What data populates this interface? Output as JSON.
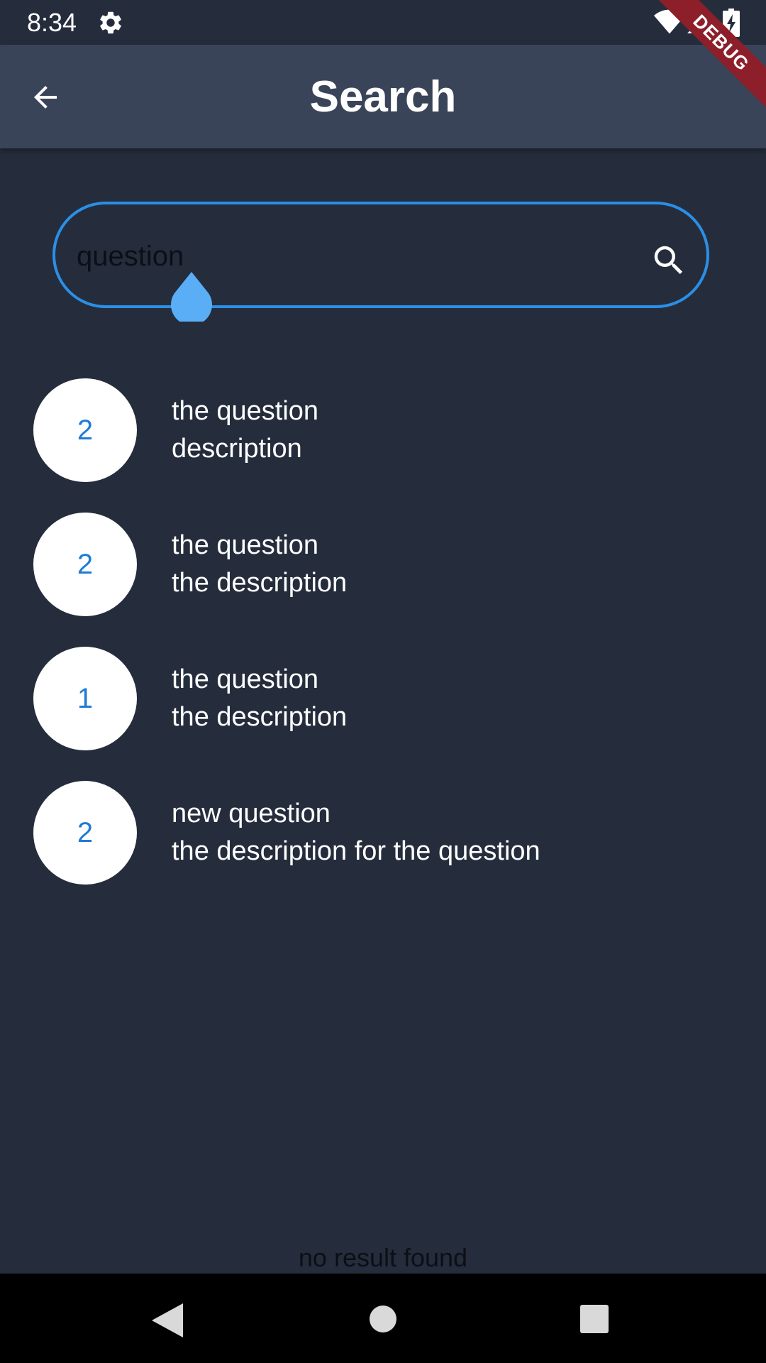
{
  "status_bar": {
    "time": "8:34",
    "icons": [
      "gear-icon",
      "wifi-icon",
      "signal-icon",
      "battery-charging-icon"
    ]
  },
  "debug_banner": "DEBUG",
  "app_bar": {
    "title": "Search",
    "back_icon": "arrow-left-icon"
  },
  "search": {
    "value": "question",
    "icon": "search-icon",
    "border_color": "#2b8fe6"
  },
  "results": [
    {
      "count": "2",
      "title": "the question",
      "description": "description"
    },
    {
      "count": "2",
      "title": "the question",
      "description": "the description"
    },
    {
      "count": "1",
      "title": "the question",
      "description": "the description"
    },
    {
      "count": "2",
      "title": "new question",
      "description": "the description for the question"
    }
  ],
  "empty_message": "no result found",
  "nav_bar": {
    "icons": [
      "nav-back-icon",
      "nav-home-icon",
      "nav-recents-icon"
    ]
  },
  "colors": {
    "background": "#252d3d",
    "app_bar": "#3a4459",
    "accent": "#2b8fe6",
    "count_text": "#1e7bd6"
  }
}
